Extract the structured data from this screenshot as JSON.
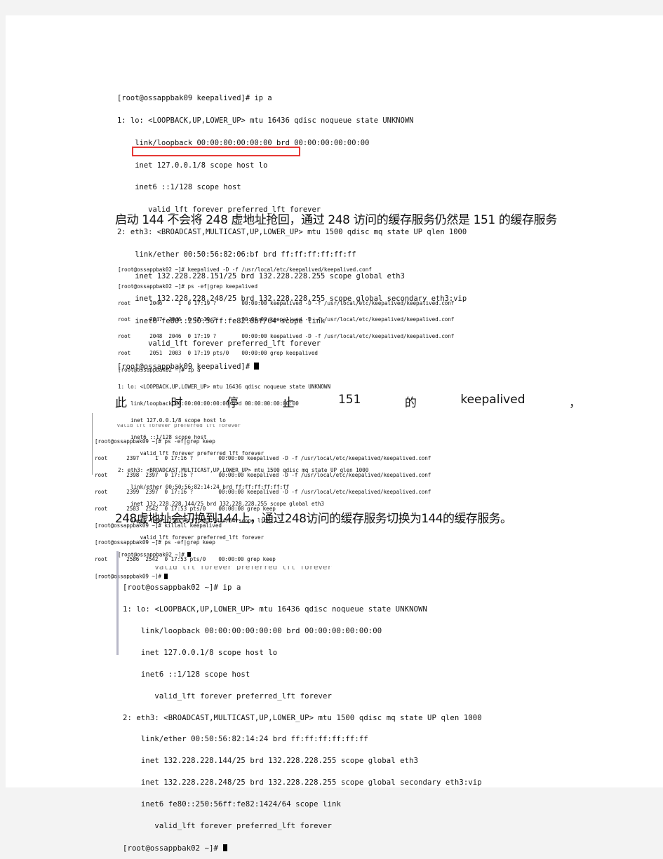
{
  "document": {
    "terminal_1": {
      "lines": [
        "[root@ossappbak09 keepalived]# ip a",
        "1: lo: <LOOPBACK,UP,LOWER_UP> mtu 16436 qdisc noqueue state UNKNOWN",
        "    link/loopback 00:00:00:00:00:00 brd 00:00:00:00:00:00",
        "    inet 127.0.0.1/8 scope host lo",
        "    inet6 ::1/128 scope host",
        "       valid_lft forever preferred_lft forever",
        "2: eth3: <BROADCAST,MULTICAST,UP,LOWER_UP> mtu 1500 qdisc mq state UP qlen 1000",
        "    link/ether 00:50:56:82:06:bf brd ff:ff:ff:ff:ff:ff",
        "    inet 132.228.228.151/25 brd 132.228.228.255 scope global eth3",
        "    inet 132.228.228.248/25 brd 132.228.228.255 scope global secondary eth3:vip",
        "    inet6 fe80::250:56ff:fe82:6bf/64 scope link",
        "       valid_lft forever preferred_lft forever"
      ],
      "prompt": "[root@ossappbak09 keepalived]# ",
      "highlight_text": "inet 132.228.228.248/25 brd 132.228.",
      "highlight_color": "#e53935"
    },
    "paragraph_1": "启动 144 不会将 248 虚地址抢回，通过 248 访问的缓存服务仍然是 151 的缓存服务",
    "terminal_2": {
      "lines": [
        "[root@ossappbak02 ~]# keepalived -D -f /usr/local/etc/keepalived/keepalived.conf",
        "[root@ossappbak02 ~]# ps -ef|grep keepalived",
        "root      2046     1  0 17:19 ?        00:00:00 keepalived -D -f /usr/local/etc/keepalived/keepalived.conf",
        "root      2047  2046  0 17:19 ?        00:00:00 keepalived -D -f /usr/local/etc/keepalived/keepalived.conf",
        "root      2048  2046  0 17:19 ?        00:00:00 keepalived -D -f /usr/local/etc/keepalived/keepalived.conf",
        "root      2051  2003  0 17:19 pts/0    00:00:00 grep keepalived",
        "[root@ossappbak02 ~]# ip a",
        "1: lo: <LOOPBACK,UP,LOWER_UP> mtu 16436 qdisc noqueue state UNKNOWN",
        "    link/loopback 00:00:00:00:00:00 brd 00:00:00:00:00:00",
        "    inet 127.0.0.1/8 scope host lo",
        "    inet6 ::1/128 scope host",
        "       valid_lft forever preferred_lft forever",
        "2: eth3: <BROADCAST,MULTICAST,UP,LOWER_UP> mtu 1500 qdisc mq state UP qlen 1000",
        "    link/ether 00:50:56:82:14:24 brd ff:ff:ff:ff:ff:ff",
        "    inet 132.228.228.144/25 brd 132.228.228.255 scope global eth3",
        "    inet6 fe80::250:56ff:fe82:1424/64 scope link",
        "       valid_lft forever preferred_lft forever"
      ],
      "prompt": "[root@ossappbak02 ~]# "
    },
    "paragraph_2": [
      "此",
      "时",
      "停",
      "止",
      "151",
      "的",
      "keepalived",
      "，"
    ],
    "terminal_3": {
      "clipped_first_line": "       valid_lft forever preferred_lft forever",
      "lines": [
        "[root@ossappbak09 ~]# ps -ef|grep keep",
        "root      2397     1  0 17:16 ?        00:00:00 keepalived -D -f /usr/local/etc/keepalived/keepalived.conf",
        "root      2398  2397  0 17:16 ?        00:00:00 keepalived -D -f /usr/local/etc/keepalived/keepalived.conf",
        "root      2399  2397  0 17:16 ?        00:00:00 keepalived -D -f /usr/local/etc/keepalived/keepalived.conf",
        "root      2583  2542  0 17:53 pts/0    00:00:00 grep keep",
        "[root@ossappbak09 ~]# killall keepalived",
        "[root@ossappbak09 ~]# ps -ef|grep keep",
        "root      2586  2542  0 17:53 pts/0    00:00:00 grep keep"
      ],
      "prompt": "[root@ossappbak09 ~]# "
    },
    "paragraph_3": "248虚地址会切换到144上，通过248访问的缓存服务切换为144的缓存服务。",
    "terminal_4": {
      "clipped_first_line": "       valid_lft forever preferred_lft forever",
      "lines": [
        "[root@ossappbak02 ~]# ip a",
        "1: lo: <LOOPBACK,UP,LOWER_UP> mtu 16436 qdisc noqueue state UNKNOWN",
        "    link/loopback 00:00:00:00:00:00 brd 00:00:00:00:00:00",
        "    inet 127.0.0.1/8 scope host lo",
        "    inet6 ::1/128 scope host",
        "       valid_lft forever preferred_lft forever",
        "2: eth3: <BROADCAST,MULTICAST,UP,LOWER_UP> mtu 1500 qdisc mq state UP qlen 1000",
        "    link/ether 00:50:56:82:14:24 brd ff:ff:ff:ff:ff:ff",
        "    inet 132.228.228.144/25 brd 132.228.228.255 scope global eth3",
        "    inet 132.228.228.248/25 brd 132.228.228.255 scope global secondary eth3:vip",
        "    inet6 fe80::250:56ff:fe82:1424/64 scope link",
        "       valid_lft forever preferred_lft forever"
      ],
      "prompt": "[root@ossappbak02 ~]# "
    }
  }
}
